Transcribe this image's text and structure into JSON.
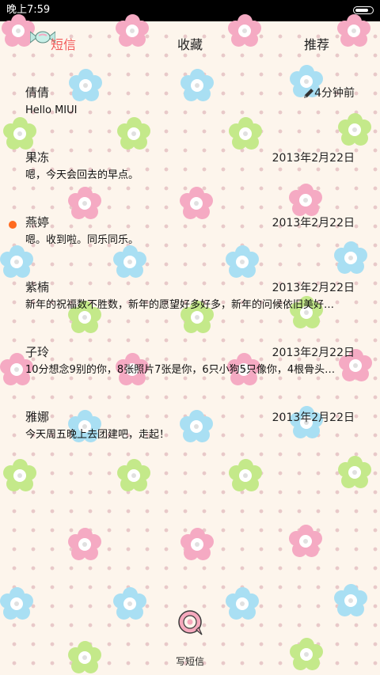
{
  "status_bar": {
    "time": "晚上7:59",
    "battery_icon": "battery-icon"
  },
  "tabs": [
    {
      "label": "短信",
      "active": true
    },
    {
      "label": "收藏",
      "active": false
    },
    {
      "label": "推荐",
      "active": false
    }
  ],
  "messages": [
    {
      "name": "倩倩",
      "time": "4分钟前",
      "preview": "Hello MIUI",
      "draft": true,
      "unread": false
    },
    {
      "name": "果冻",
      "time": "2013年2月22日",
      "preview": "嗯，今天会回去的早点。",
      "draft": false,
      "unread": false
    },
    {
      "name": "燕婷",
      "time": "2013年2月22日",
      "preview": "嗯。收到啦。同乐同乐。",
      "draft": false,
      "unread": true
    },
    {
      "name": "紫楠",
      "time": "2013年2月22日",
      "preview": "新年的祝福数不胜数，新年的愿望好多好多，新年的问候依旧美好…",
      "draft": false,
      "unread": false
    },
    {
      "name": "子玲",
      "time": "2013年2月22日",
      "preview": "10分想念9别的你，8张照片7张是你，6只小狗5只像你，4根骨头…",
      "draft": false,
      "unread": false
    },
    {
      "name": "雅娜",
      "time": "2013年2月22日",
      "preview": "今天周五晚上去团建吧，走起！",
      "draft": false,
      "unread": false
    }
  ],
  "compose": {
    "label": "写短信",
    "icon": "compose-bubble-icon"
  },
  "colors": {
    "active_tab": "#f25b5b",
    "unread_dot": "#ff6a1f",
    "background": "#fdf5ec"
  }
}
